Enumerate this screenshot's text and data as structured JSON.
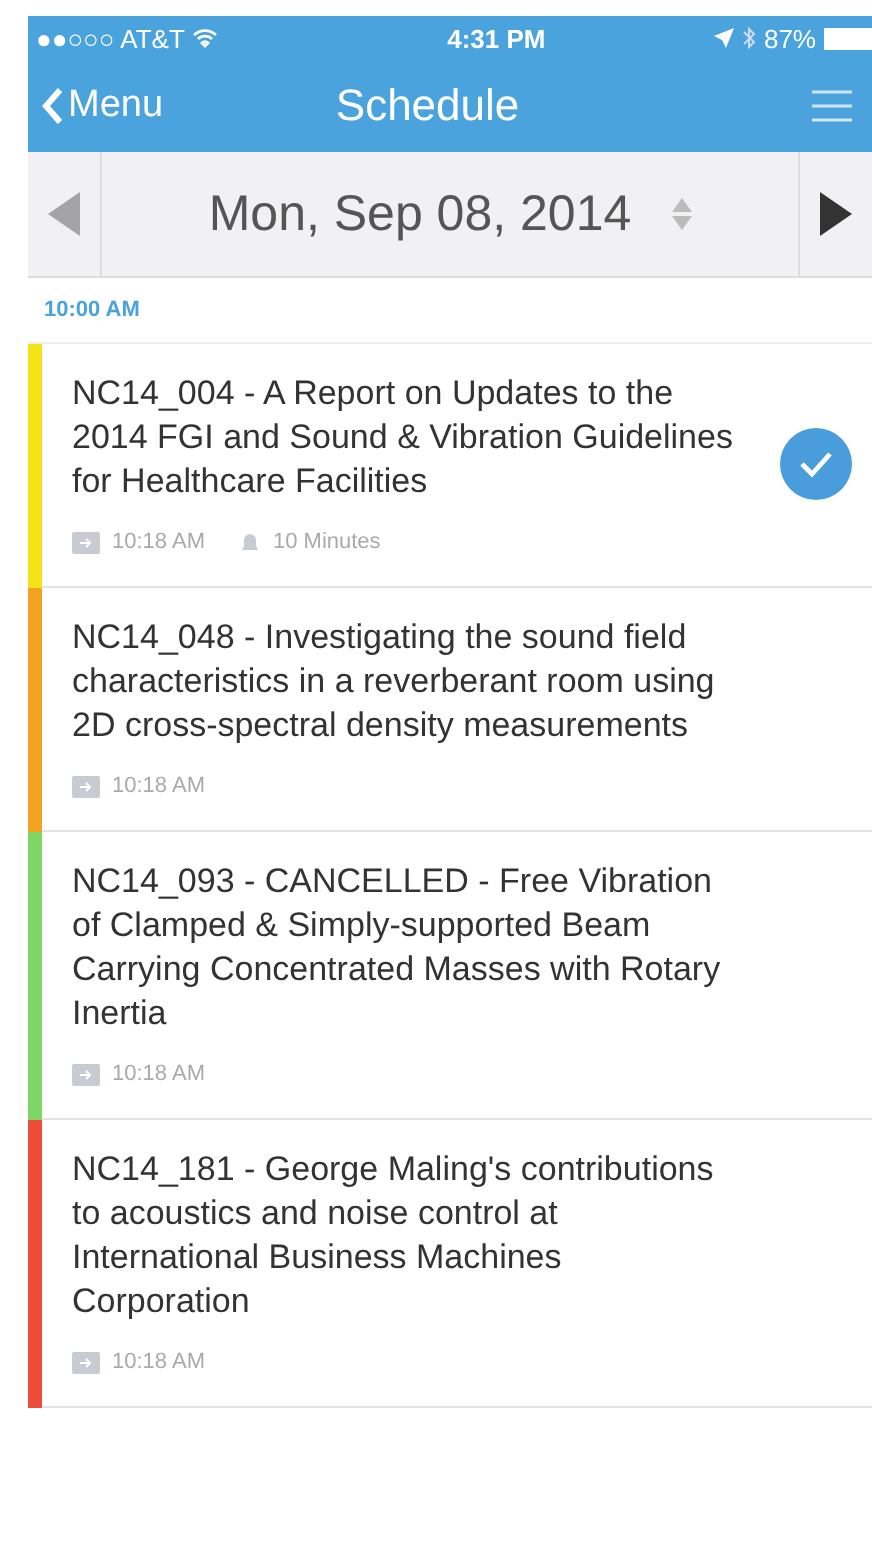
{
  "status_bar": {
    "carrier": "●●○○○ AT&T",
    "time": "4:31 PM",
    "battery": "87%"
  },
  "nav": {
    "back": "Menu",
    "title": "Schedule"
  },
  "date_bar": {
    "date": "Mon, Sep 08, 2014"
  },
  "section": {
    "time": "10:00 AM"
  },
  "sessions": [
    {
      "title": "NC14_004 - A Report on Updates to the 2014 FGI and Sound & Vibration Guidelines for Healthcare Facilities",
      "time": "10:18 AM",
      "duration": "10 Minutes",
      "color": "#f5e31a",
      "checked": true
    },
    {
      "title": "NC14_048 - Investigating the sound field characteristics in a reverberant room using  2D cross-spectral density measurements",
      "time": "10:18 AM",
      "color": "#f4a321",
      "checked": false
    },
    {
      "title": "NC14_093 - CANCELLED - Free Vibration of Clamped & Simply-supported Beam Carrying Concentrated Masses with Rotary Inertia",
      "time": "10:18 AM",
      "color": "#7ed667",
      "checked": false
    },
    {
      "title": "NC14_181 - George Maling's contributions to acoustics and noise control at International Business Machines Corporation",
      "time": "10:18 AM",
      "color": "#ec4c3a",
      "checked": false
    }
  ]
}
